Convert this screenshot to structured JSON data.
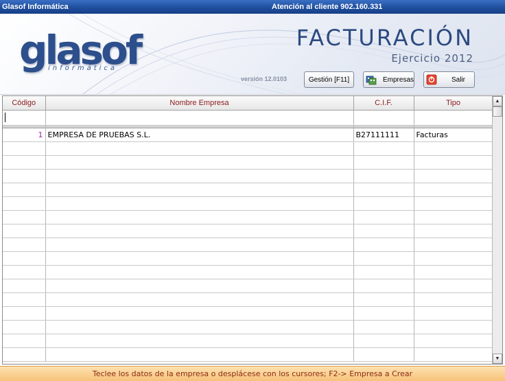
{
  "window": {
    "title": "Glasof Informática",
    "support_text": "Atención al cliente 902.160.331"
  },
  "header": {
    "logo_word": "glasof",
    "logo_sub": "informática",
    "app_title": "FACTURACIÓN",
    "fiscal_year": "Ejercicio 2012",
    "version": "versión 12.0103"
  },
  "toolbar": {
    "gestion_label": "Gestión [F11]",
    "empresas_label": "Empresas",
    "salir_label": "Salir"
  },
  "grid": {
    "columns": [
      "Código",
      "Nombre Empresa",
      "C.I.F.",
      "Tipo"
    ],
    "rows": [
      {
        "codigo": "1",
        "nombre": "EMPRESA DE PRUEBAS S.L.",
        "cif": "B27111111",
        "tipo": "Facturas"
      }
    ]
  },
  "status": {
    "hint": "Teclee los datos de la empresa o desplácese con los cursores; F2-> Empresa a Crear"
  },
  "colors": {
    "accent": "#2c4a80",
    "header_text": "#8b1a1a",
    "status_bg": "#f7c27a",
    "status_text": "#8b2a12"
  }
}
